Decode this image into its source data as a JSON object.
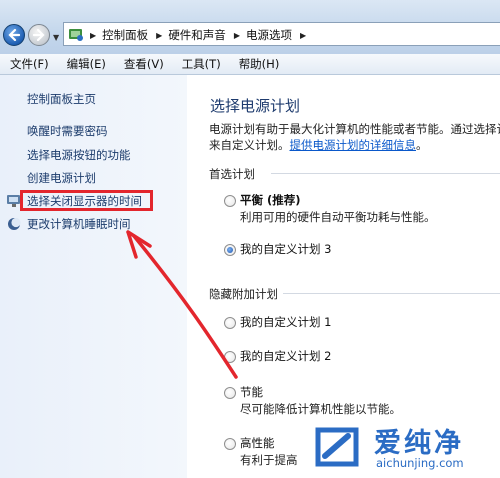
{
  "address_bar": {
    "breadcrumbs": [
      "控制面板",
      "硬件和声音",
      "电源选项"
    ]
  },
  "menu": [
    "文件(F)",
    "编辑(E)",
    "查看(V)",
    "工具(T)",
    "帮助(H)"
  ],
  "sidebar": {
    "home": "控制面板主页",
    "links": [
      {
        "label": "唤醒时需要密码",
        "icon": ""
      },
      {
        "label": "选择电源按钮的功能",
        "icon": ""
      },
      {
        "label": "创建电源计划",
        "icon": ""
      },
      {
        "label": "选择关闭显示器的时间",
        "icon": "monitor-icon",
        "highlighted": true
      },
      {
        "label": "更改计算机睡眠时间",
        "icon": "moon-icon"
      }
    ]
  },
  "main": {
    "title": "选择电源计划",
    "description_line1": "电源计划有助于最大化计算机的性能或者节能。通过选择计",
    "description_line2_prefix": "来自定义计划。",
    "description_link": "提供电源计划的详细信息",
    "description_line2_suffix": "。",
    "preferred_section": "首选计划",
    "preferred_plans": [
      {
        "name": "平衡 (推荐)",
        "desc": "利用可用的硬件自动平衡功耗与性能。",
        "checked": false,
        "bold": true
      },
      {
        "name": "我的自定义计划 3",
        "desc": "",
        "checked": true,
        "bold": false
      }
    ],
    "hidden_section": "隐藏附加计划",
    "hidden_plans": [
      {
        "name": "我的自定义计划 1",
        "desc": "",
        "checked": false
      },
      {
        "name": "我的自定义计划 2",
        "desc": "",
        "checked": false
      },
      {
        "name": "节能",
        "desc": "尽可能降低计算机性能以节能。",
        "checked": false
      },
      {
        "name": "高性能",
        "desc": "有利于提高",
        "checked": false
      }
    ]
  },
  "watermark": {
    "brand": "爱纯净",
    "url": "aichunjing.com"
  },
  "colors": {
    "highlight_box": "#e3262d",
    "arrow": "#e3262d",
    "link": "#0a58ca",
    "title": "#1e3b6e"
  }
}
